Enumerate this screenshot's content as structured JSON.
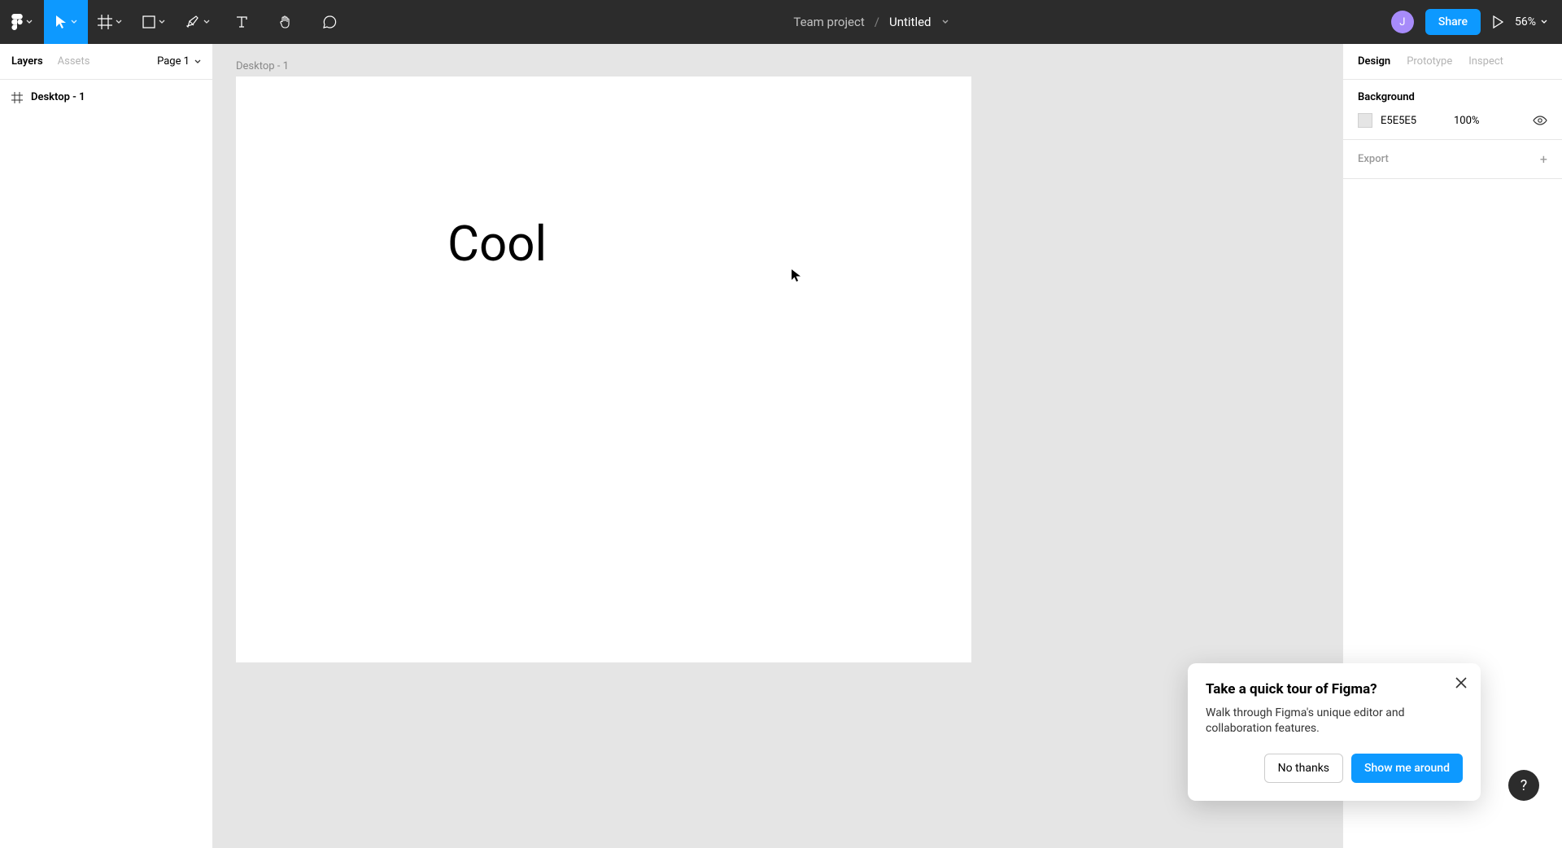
{
  "toolbar": {
    "team_label": "Team project",
    "file_name": "Untitled",
    "avatar_initial": "J",
    "share_label": "Share",
    "zoom_label": "56%"
  },
  "left_panel": {
    "tab_layers": "Layers",
    "tab_assets": "Assets",
    "page_label": "Page 1",
    "layers": [
      {
        "name": "Desktop - 1"
      }
    ]
  },
  "canvas": {
    "frame_label": "Desktop - 1",
    "text_content": "Cool"
  },
  "right_panel": {
    "tab_design": "Design",
    "tab_prototype": "Prototype",
    "tab_inspect": "Inspect",
    "section_background": "Background",
    "bg_hex": "E5E5E5",
    "bg_opacity": "100%",
    "section_export": "Export"
  },
  "tour": {
    "title": "Take a quick tour of Figma?",
    "body": "Walk through Figma's unique editor and collaboration features.",
    "no_thanks": "No thanks",
    "show_me": "Show me around"
  },
  "help_label": "?"
}
